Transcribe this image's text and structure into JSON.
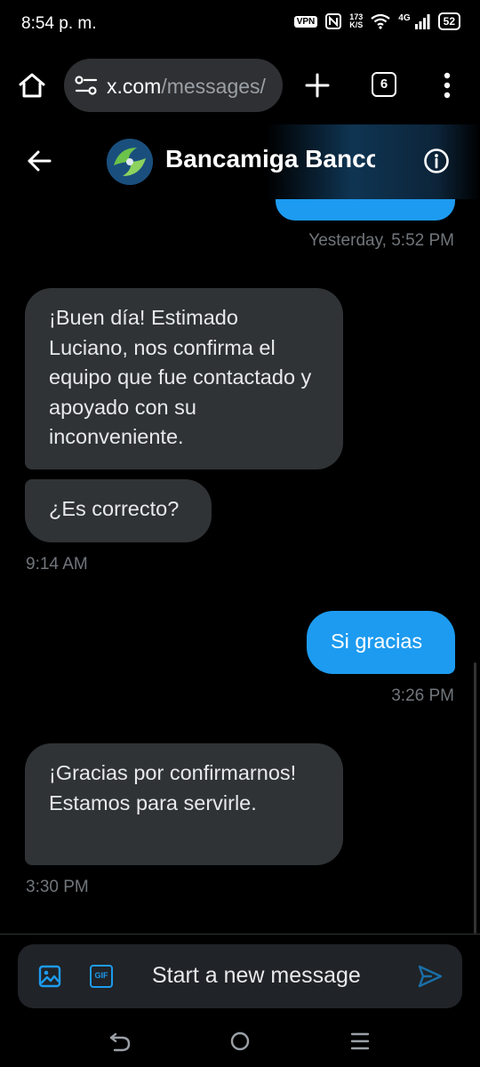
{
  "status_bar": {
    "time": "8:54 p. m.",
    "vpn": "VPN",
    "speed_value": "173",
    "speed_unit": "K/S",
    "network": "4G",
    "battery": "52"
  },
  "browser": {
    "url_domain": "x.com",
    "url_path": "/messages/",
    "tab_count": "6",
    "icons": [
      "home-icon",
      "site-settings-icon",
      "plus-icon",
      "tabs-icon",
      "more-vert-icon"
    ]
  },
  "header": {
    "title": "Bancamiga Banco",
    "icons": [
      "back-arrow-icon",
      "info-icon"
    ]
  },
  "messages": [
    {
      "direction": "out",
      "partial": true,
      "text": "",
      "timestamp": "Yesterday, 5:52 PM"
    },
    {
      "direction": "in",
      "text": "¡Buen día! Estimado Luciano, nos confirma el equipo que fue contactado y apoyado con su inconveniente."
    },
    {
      "direction": "in",
      "text": "¿Es correcto?",
      "timestamp": "9:14 AM"
    },
    {
      "direction": "out",
      "text": "Si gracias",
      "timestamp": "3:26 PM"
    },
    {
      "direction": "in",
      "text": "¡Gracias por confirmarnos! Estamos para servirle.",
      "timestamp": "3:30 PM"
    }
  ],
  "composer": {
    "placeholder": "Start a new message",
    "gif_label": "GIF",
    "icons": [
      "image-icon",
      "gif-icon",
      "send-icon"
    ]
  },
  "colors": {
    "accent": "#1d9bf0",
    "incoming_bubble": "#2f3336",
    "background": "#000000",
    "timestamp": "#71767b"
  }
}
